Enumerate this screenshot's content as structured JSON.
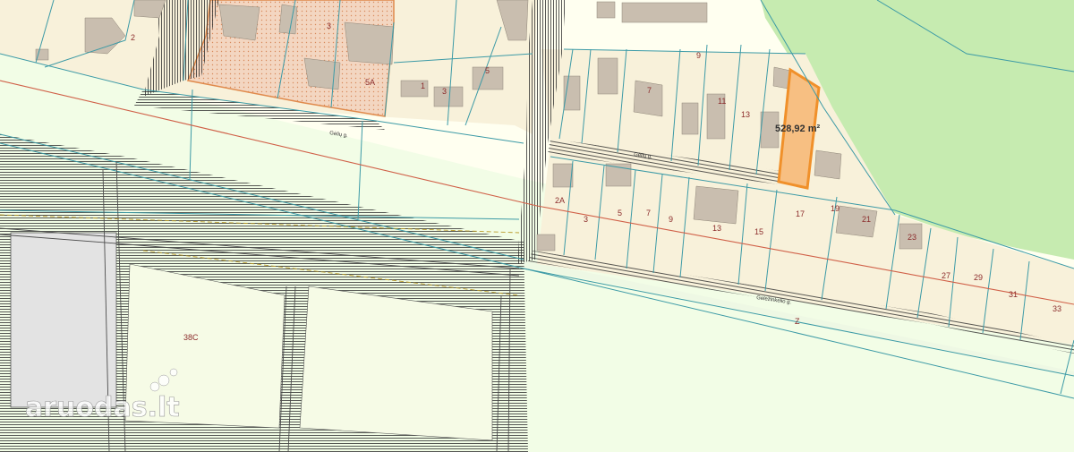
{
  "map": {
    "highlight_area": "528,92 m²",
    "watermark": "aruodas.lt",
    "street_labels": [
      "Gėlių g.",
      "Gėlių g.",
      "Geležinkelio g."
    ],
    "parcels": {
      "p2": "2",
      "p3b": "3",
      "p5a": "5A",
      "p7top": "7",
      "p9top": "9",
      "p11top": "11",
      "p13top": "13",
      "p2a": "2A",
      "p3": "3",
      "p5": "5",
      "p7": "7",
      "p9": "9",
      "p13": "13",
      "p15": "15",
      "p17": "17",
      "p19": "19",
      "p21": "21",
      "p23": "23",
      "p27": "27",
      "p29": "29",
      "p31": "31",
      "p33": "33",
      "z": "Z",
      "p38c": "38C",
      "p1": "1",
      "p3t": "3",
      "p5t": "5"
    },
    "colors": {
      "background": "#fffff0",
      "green_area": "#c6ebb0",
      "highlight_fill": "#f7bf82",
      "highlight_stroke": "#f0902a",
      "boundary": "#3c9aa6",
      "rail_hatch": "#2e2e2e",
      "red_line": "#d06048",
      "building": "#c9beaf",
      "protected_zone": "#f3d6c1",
      "lot_label": "#8b2b2b"
    }
  }
}
